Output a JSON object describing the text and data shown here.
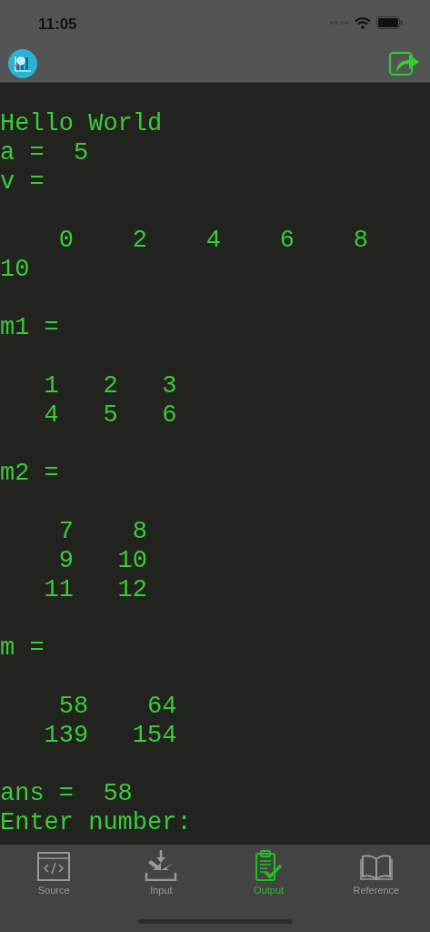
{
  "status_bar": {
    "time": "11:05"
  },
  "output_blocks": [
    {
      "lines": [
        "Hello World",
        "a =  5",
        "v ="
      ]
    },
    {
      "lines": [
        "    0    2    4    6    8",
        "10"
      ]
    },
    {
      "lines": [
        "m1 ="
      ]
    },
    {
      "lines": [
        "   1   2   3",
        "   4   5   6"
      ]
    },
    {
      "lines": [
        "m2 ="
      ]
    },
    {
      "lines": [
        "    7    8",
        "    9   10",
        "   11   12"
      ]
    },
    {
      "lines": [
        "m ="
      ]
    },
    {
      "lines": [
        "    58    64",
        "   139   154"
      ]
    },
    {
      "lines": [
        "ans =  58",
        "Enter number:"
      ]
    }
  ],
  "tabs": [
    {
      "label": "Source",
      "kind": "code",
      "selected": false
    },
    {
      "label": "Input",
      "kind": "input",
      "selected": false
    },
    {
      "label": "Output",
      "kind": "output",
      "selected": true
    },
    {
      "label": "Reference",
      "kind": "book",
      "selected": false
    }
  ]
}
